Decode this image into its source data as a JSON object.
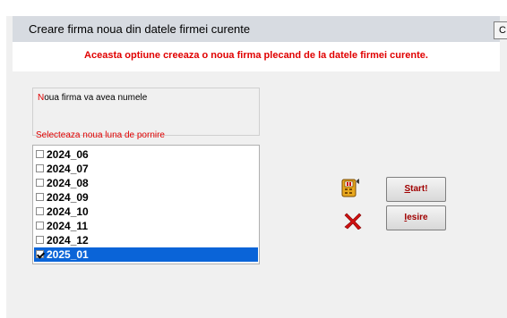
{
  "window": {
    "title": "Creare firma noua din datele firmei curente",
    "right_tab_label": "C"
  },
  "info": {
    "message": "Aceasta optiune creeaza o noua firma plecand de la datele firmei curente."
  },
  "name_field": {
    "label_first": "N",
    "label_rest": "oua firma va avea numele",
    "value": ""
  },
  "month_section": {
    "label": "Selecteaza noua luna de pornire",
    "items": [
      {
        "label": "2024_06",
        "checked": false,
        "selected": false
      },
      {
        "label": "2024_07",
        "checked": false,
        "selected": false
      },
      {
        "label": "2024_08",
        "checked": false,
        "selected": false
      },
      {
        "label": "2024_09",
        "checked": false,
        "selected": false
      },
      {
        "label": "2024_10",
        "checked": false,
        "selected": false
      },
      {
        "label": "2024_11",
        "checked": false,
        "selected": false
      },
      {
        "label": "2024_12",
        "checked": false,
        "selected": false
      },
      {
        "label": "2025_01",
        "checked": true,
        "selected": true
      }
    ]
  },
  "buttons": {
    "start_first": "S",
    "start_rest": "tart!",
    "exit_first": "I",
    "exit_rest": "esire"
  },
  "icons": {
    "start": "calculator-icon",
    "exit": "red-x-icon"
  },
  "colors": {
    "accent_red": "#e00000",
    "selection_blue": "#0a64d8",
    "title_bar": "#d7dbe1"
  }
}
